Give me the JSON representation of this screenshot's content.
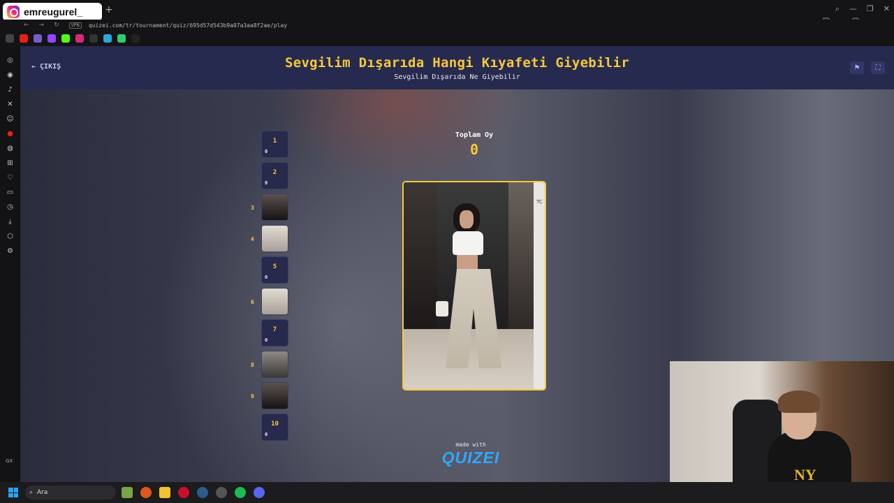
{
  "browser": {
    "instagram_handle": "emreugurel_",
    "new_tab": "+",
    "url": "quizei.com/tr/tournament/quiz/695d57d543b9a07a3aa8f2ae/play",
    "vpn_label": "VPN",
    "watermark": "BynoGame",
    "window_controls": [
      "⌕",
      "—",
      "❐",
      "✕"
    ]
  },
  "gx_sidebar": {
    "label": "GX",
    "items": [
      "twitch-icon",
      "instagram-icon",
      "tiktok-icon",
      "x-icon",
      "discord-icon",
      "youtube-icon",
      "spotify-icon",
      "apps-icon",
      "heart-icon",
      "wallet-icon",
      "history-icon",
      "download-icon",
      "extensions-icon",
      "settings-icon"
    ]
  },
  "header": {
    "exit_label": "ÇIKIŞ",
    "title": "Sevgilim Dışarıda Hangi Kıyafeti Giyebilir",
    "subtitle": "Sevgilim Dışarıda Ne Giyebilir"
  },
  "slots": [
    {
      "num": "1",
      "votes": "0",
      "has_image": false
    },
    {
      "num": "2",
      "votes": "0",
      "has_image": false
    },
    {
      "num": "3",
      "votes": "",
      "has_image": true
    },
    {
      "num": "4",
      "votes": "",
      "has_image": true
    },
    {
      "num": "5",
      "votes": "0",
      "has_image": false
    },
    {
      "num": "6",
      "votes": "",
      "has_image": true
    },
    {
      "num": "7",
      "votes": "0",
      "has_image": false
    },
    {
      "num": "8",
      "votes": "",
      "has_image": true
    },
    {
      "num": "9",
      "votes": "",
      "has_image": true
    },
    {
      "num": "10",
      "votes": "0",
      "has_image": false
    }
  ],
  "total": {
    "label": "Toplam Oy",
    "value": "0"
  },
  "card": {
    "sign_text": "TC"
  },
  "footer": {
    "made_with": "made with",
    "logo": "QUIZEI"
  },
  "taskbar": {
    "search_placeholder": "Ara"
  },
  "colors": {
    "accent": "#f7c93a",
    "header_bg": "#262a4f",
    "slot_bg": "#272a4d",
    "logo": "#2ea8ff"
  }
}
